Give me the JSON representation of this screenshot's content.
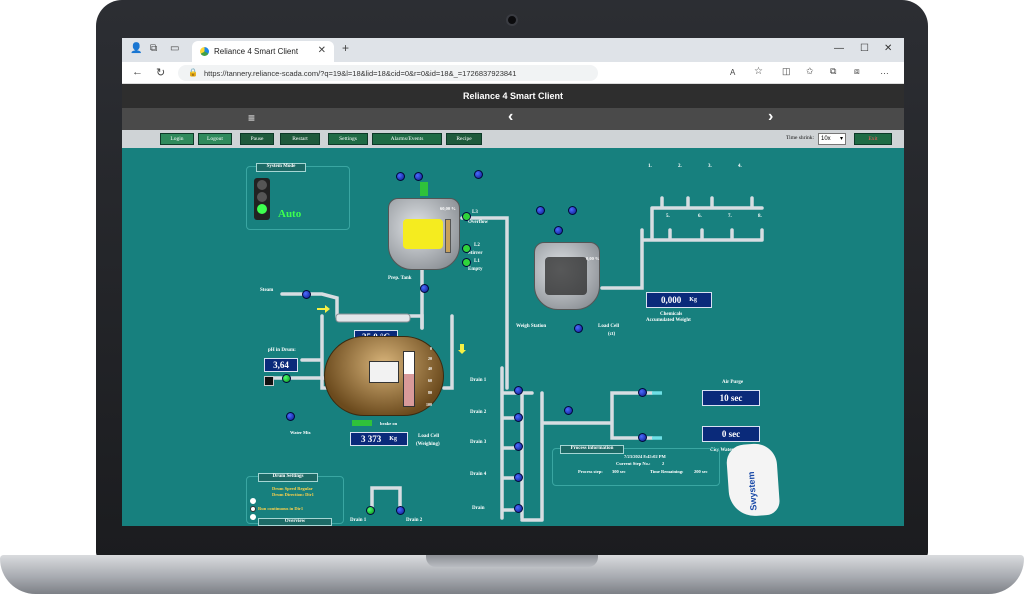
{
  "browser": {
    "tab_title": "Reliance 4 Smart Client",
    "new_tab": "+",
    "url": "https://tannery.reliance-scada.com/?q=19&l=18&lid=18&cid=0&r=0&id=18&_=1726837923841"
  },
  "app": {
    "title": "Reliance 4 Smart Client",
    "nav": {
      "menu_icon": "≡",
      "prev": "‹",
      "next": "›"
    }
  },
  "menubar": {
    "buttons": [
      {
        "label": "Login"
      },
      {
        "label": "Logout"
      },
      {
        "label": "Pause"
      },
      {
        "label": "Restart"
      },
      {
        "label": "Settings"
      },
      {
        "label": "Alarms/Events"
      },
      {
        "label": "Recipe"
      }
    ],
    "time_shrink_label": "Time shrink:",
    "time_shrink_value": "10x",
    "exit_label": "Exit"
  },
  "hmi": {
    "system_mode": {
      "title": "System Mode",
      "value": "Auto"
    },
    "prep_tank": {
      "label": "Prep. Tank",
      "percent": "60,00 %",
      "l3": "L3",
      "overflow": "Overflow",
      "l2": "L2",
      "stirrer": "Stirrer",
      "l1": "L1",
      "empty": "Empty"
    },
    "weigh_station": {
      "label": "Weigh Station",
      "percent": "0,00 %",
      "load_cell": "Load Cell",
      "load_cell_sub": "(ct)"
    },
    "steam_label": "Steam",
    "temperature": "35,0 °C",
    "ph": {
      "label": "pH in Drum:",
      "value": "3,64"
    },
    "water_mix": "Water Mix",
    "drum": {
      "brake": "brake on",
      "weight": "3 373",
      "weight_unit": "Kg",
      "load_cell": "Load Cell",
      "load_cell_sub": "(Weighing)",
      "scale": [
        "0",
        "20",
        "40",
        "60",
        "80",
        "100"
      ]
    },
    "chemicals": {
      "value": "0,000",
      "unit": "Kg",
      "label1": "Chemicals",
      "label2": "Accumulated Weight"
    },
    "chem_valves": [
      "1.",
      "2.",
      "3.",
      "4.",
      "5.",
      "6.",
      "7.",
      "8."
    ],
    "drains": [
      "Drain 1",
      "Drain 2",
      "Drain 3",
      "Drain 4",
      "Drain"
    ],
    "air_purge": {
      "label": "Air Purge",
      "value": "10 sec"
    },
    "city_water": {
      "label": "City Water purge",
      "value": "0 sec"
    },
    "drum_settings": {
      "title": "Drum Settings",
      "opt1": "Drum Speed Regular",
      "opt2": "Drum Direction: Dir1",
      "opt3": "Run continuous in Dir1",
      "overview": "Overview"
    },
    "bottom_drains": [
      "Drain 1",
      "Drain 2"
    ],
    "process_info": {
      "title": "Process information",
      "datetime": "7/23/2024 8:45:02 PM",
      "current_step_label": "Current Step No.:",
      "current_step": "2",
      "process_step_label": "Process step:",
      "process_step": "300 sec",
      "time_remaining_label": "Time Remaining:",
      "time_remaining": "200 sec"
    },
    "logo_text": "Swystem",
    "colors": {
      "bg": "#17807e",
      "pv_box": "#0a2a7a",
      "menu_btn": "#1f6b45",
      "auto": "#3dff4f"
    }
  }
}
